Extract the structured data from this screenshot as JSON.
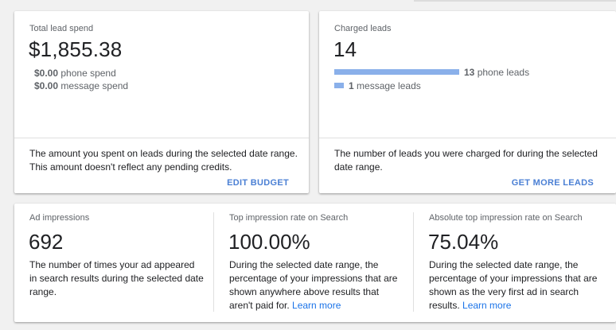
{
  "spend_card": {
    "title": "Total lead spend",
    "value": "$1,855.38",
    "phone_amount": "$0.00",
    "phone_text": "phone spend",
    "message_amount": "$0.00",
    "message_text": "message spend",
    "description": "The amount you spent on leads during the selected date range. This amount doesn't reflect any pending credits.",
    "action": "EDIT BUDGET"
  },
  "leads_card": {
    "title": "Charged leads",
    "value": "14",
    "phone_count": "13",
    "phone_text": "phone leads",
    "message_count": "1",
    "message_text": "message leads",
    "phone_fraction": 0.929,
    "message_fraction": 0.071,
    "bar_color": "#8ab0ea",
    "description": "The number of leads you were charged for during the selected date range.",
    "action": "GET MORE LEADS"
  },
  "metrics": [
    {
      "title": "Ad impressions",
      "value": "692",
      "description": "The number of times your ad appeared in search results during the selected date range.",
      "link": ""
    },
    {
      "title": "Top impression rate on Search",
      "value": "100.00%",
      "description": "During the selected date range, the percentage of your impressions that are shown anywhere above results that aren't paid for.",
      "link": "Learn more"
    },
    {
      "title": "Absolute top impression rate on Search",
      "value": "75.04%",
      "description": "During the selected date range, the percentage of your impressions that are shown as the very first ad in search results.",
      "link": "Learn more"
    }
  ],
  "colors": {
    "accent": "#4a7fd4",
    "link": "#1a73e8"
  }
}
